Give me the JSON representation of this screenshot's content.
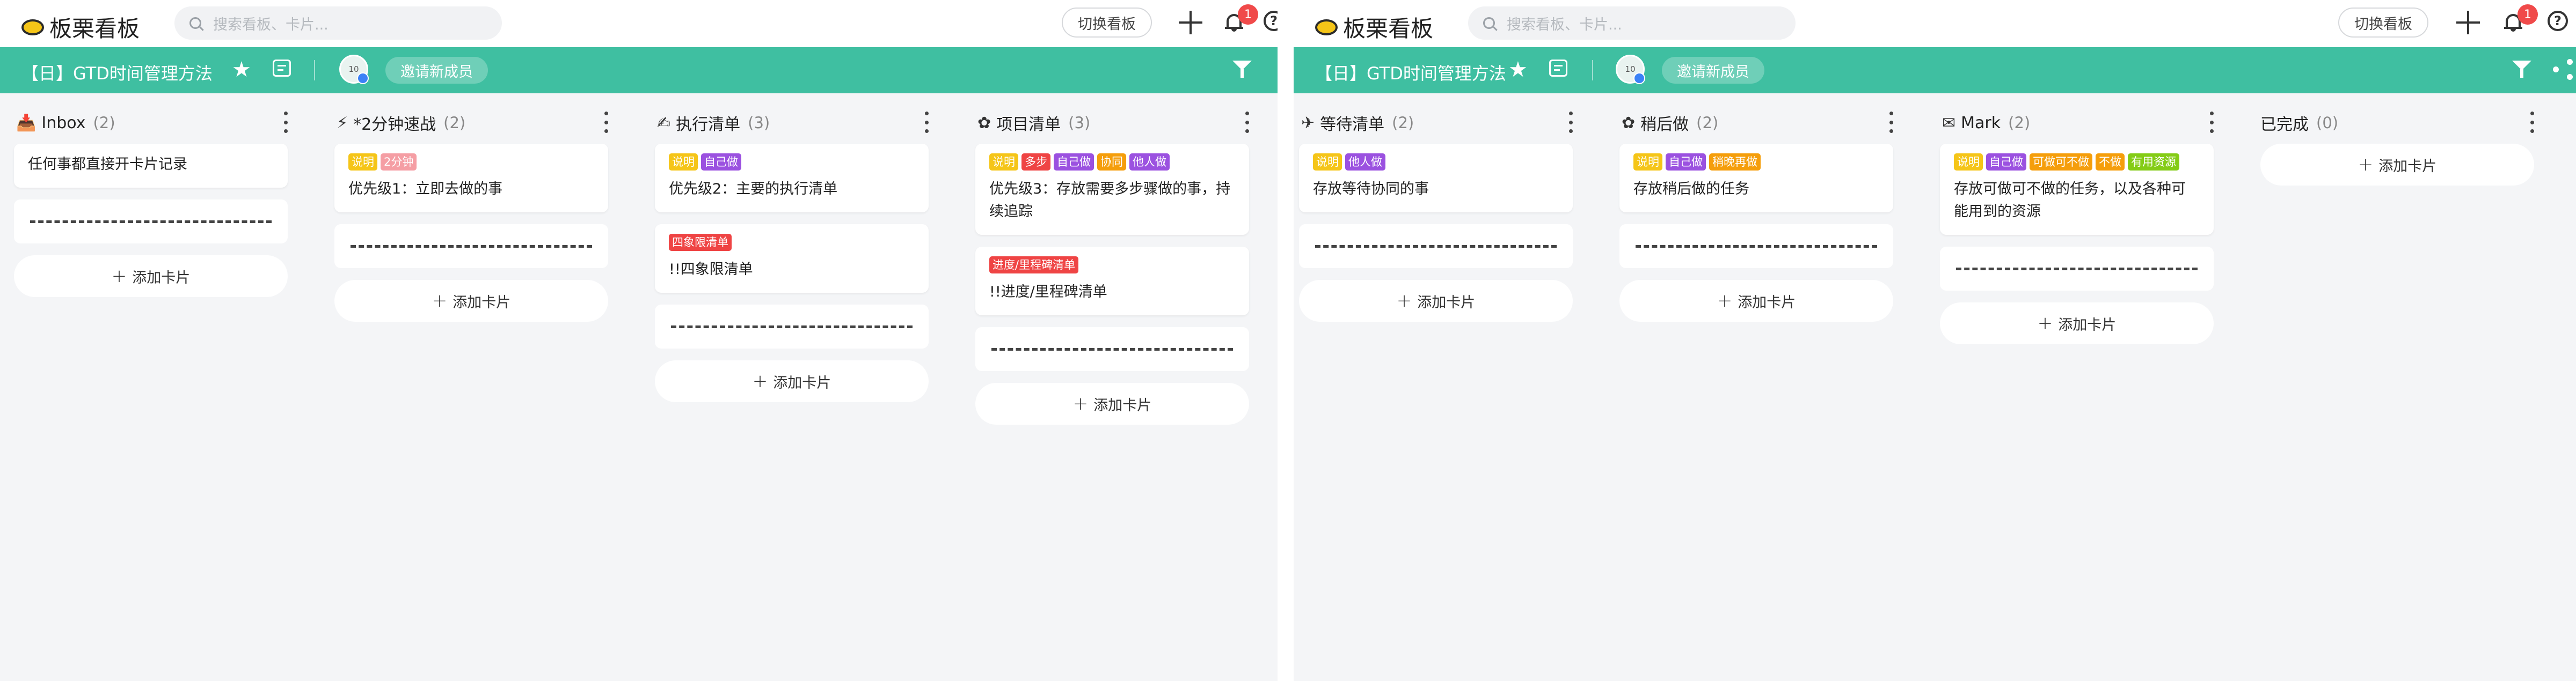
{
  "app": {
    "name": "板栗看板"
  },
  "search": {
    "placeholder": "搜索看板、卡片..."
  },
  "topbar": {
    "switch_label": "切换看板",
    "notification_count": "1"
  },
  "board": {
    "title": "【日】GTD时间管理方法",
    "invite_label": "邀请新成员",
    "avatar_text": "10"
  },
  "add_card_label": "添加卡片",
  "tag_colors": {
    "说明": "#f5c518",
    "2分钟": "#f59ea4",
    "自己做": "#9b51e0",
    "四象限清单": "#ef4444",
    "多步": "#ef4444",
    "协同": "#f59e0b",
    "他人做": "#9b51e0",
    "进度/里程碑清单": "#ef4444",
    "稍晚再做": "#f59e0b",
    "可做可不做": "#f59e0b",
    "不做": "#f59e0b",
    "有用资源": "#84cc16"
  },
  "left_lists": [
    {
      "icon": "📥",
      "title": "Inbox",
      "count": "(2)",
      "cards": [
        {
          "tags": [],
          "text": "任何事都直接开卡片记录"
        },
        {
          "divider": true
        }
      ]
    },
    {
      "icon": "⚡",
      "title": "*2分钟速战",
      "count": "(2)",
      "cards": [
        {
          "tags": [
            "说明",
            "2分钟"
          ],
          "text": "优先级1：立即去做的事"
        },
        {
          "divider": true
        }
      ]
    },
    {
      "icon": "✍",
      "title": "执行清单",
      "count": "(3)",
      "cards": [
        {
          "tags": [
            "说明",
            "自己做"
          ],
          "text": "优先级2：主要的执行清单"
        },
        {
          "tags": [
            "四象限清单"
          ],
          "text": "!!四象限清单"
        },
        {
          "divider": true
        }
      ]
    },
    {
      "icon": "✿",
      "title": "项目清单",
      "count": "(3)",
      "cards": [
        {
          "tags": [
            "说明",
            "多步",
            "自己做",
            "协同",
            "他人做"
          ],
          "text": "优先级3：存放需要多步骤做的事，持续追踪"
        },
        {
          "tags": [
            "进度/里程碑清单"
          ],
          "text": "!!进度/里程碑清单"
        },
        {
          "divider": true
        }
      ]
    }
  ],
  "right_lists": [
    {
      "icon": "✈",
      "title": "等待清单",
      "count": "(2)",
      "cards": [
        {
          "tags": [
            "说明",
            "他人做"
          ],
          "text": "存放等待协同的事"
        },
        {
          "divider": true
        }
      ]
    },
    {
      "icon": "✿",
      "title": "稍后做",
      "count": "(2)",
      "cards": [
        {
          "tags": [
            "说明",
            "自己做",
            "稍晚再做"
          ],
          "text": "存放稍后做的任务"
        },
        {
          "divider": true
        }
      ]
    },
    {
      "icon": "✉",
      "title": "Mark",
      "count": "(2)",
      "cards": [
        {
          "tags": [
            "说明",
            "自己做",
            "可做可不做",
            "不做",
            "有用资源"
          ],
          "text": "存放可做可不做的任务，以及各种可能用到的资源"
        },
        {
          "divider": true
        }
      ]
    },
    {
      "icon": "",
      "title": "已完成",
      "count": "(0)",
      "cards": []
    }
  ]
}
